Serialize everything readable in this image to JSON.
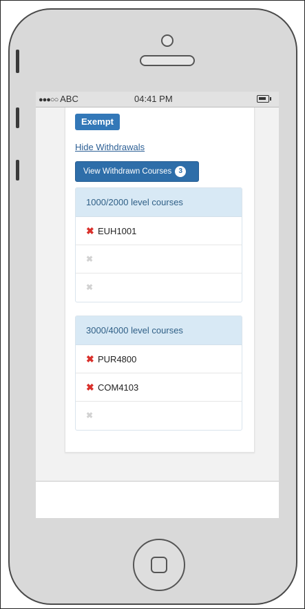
{
  "status_bar": {
    "signal": "●●●○○",
    "carrier": "ABC",
    "time": "04:41 PM"
  },
  "actions": {
    "exempt_label": "Exempt",
    "hide_withdrawals_label": "Hide Withdrawals",
    "view_withdrawn_label": "View Withdrawn Courses",
    "withdrawn_count": "3"
  },
  "groups": [
    {
      "header": "1000/2000 level courses",
      "rows": [
        {
          "course": "EUH1001",
          "icon": "remove-icon"
        },
        {
          "course": "",
          "icon": "remove-icon-disabled"
        },
        {
          "course": "",
          "icon": "remove-icon-disabled"
        }
      ]
    },
    {
      "header": "3000/4000 level courses",
      "rows": [
        {
          "course": "PUR4800",
          "icon": "remove-icon"
        },
        {
          "course": "COM4103",
          "icon": "remove-icon"
        },
        {
          "course": "",
          "icon": "remove-icon-disabled"
        }
      ]
    }
  ],
  "colors": {
    "primary_button": "#3378b8",
    "group_header_bg": "#d8e9f5",
    "remove_icon": "#d9302b",
    "remove_icon_disabled": "#d2d2d2"
  }
}
